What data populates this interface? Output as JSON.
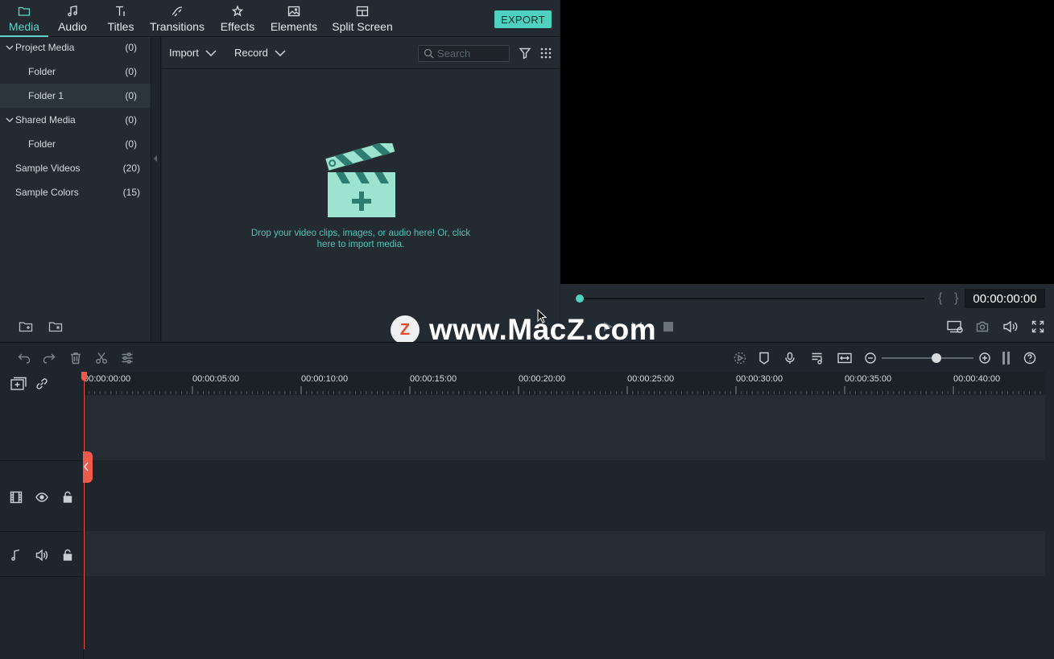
{
  "nav": {
    "tabs": [
      {
        "label": "Media",
        "icon": "folder-icon"
      },
      {
        "label": "Audio",
        "icon": "music-note-icon"
      },
      {
        "label": "Titles",
        "icon": "text-icon"
      },
      {
        "label": "Transitions",
        "icon": "transition-icon"
      },
      {
        "label": "Effects",
        "icon": "effects-icon"
      },
      {
        "label": "Elements",
        "icon": "image-icon"
      },
      {
        "label": "Split Screen",
        "icon": "split-screen-icon"
      }
    ],
    "active_tab": "Media",
    "export_label": "EXPORT"
  },
  "media_tree": {
    "items": [
      {
        "label": "Project Media",
        "count": "(0)"
      },
      {
        "label": "Folder",
        "count": "(0)"
      },
      {
        "label": "Folder 1",
        "count": "(0)"
      },
      {
        "label": "Shared Media",
        "count": "(0)"
      },
      {
        "label": "Folder",
        "count": "(0)"
      },
      {
        "label": "Sample Videos",
        "count": "(20)"
      },
      {
        "label": "Sample Colors",
        "count": "(15)"
      }
    ]
  },
  "media_toolbar": {
    "import_label": "Import",
    "record_label": "Record",
    "search_placeholder": "Search"
  },
  "media_area": {
    "drop_text": "Drop your video clips, images, or audio here! Or, click here to import media."
  },
  "preview": {
    "timecode": "00:00:00:00",
    "progress": 0
  },
  "watermark": {
    "logo_letter": "Z",
    "text": "www.MacZ.com"
  },
  "timeline": {
    "ruler_labels": [
      "00:00:00:00",
      "00:00:05:00",
      "00:00:10:00",
      "00:00:15:00",
      "00:00:20:00",
      "00:00:25:00",
      "00:00:30:00",
      "00:00:35:00",
      "00:00:40:00"
    ]
  },
  "colors": {
    "accent": "#4fd1c0",
    "playhead": "#f0584a",
    "panel": "#232a31",
    "background": "#1f252c"
  }
}
